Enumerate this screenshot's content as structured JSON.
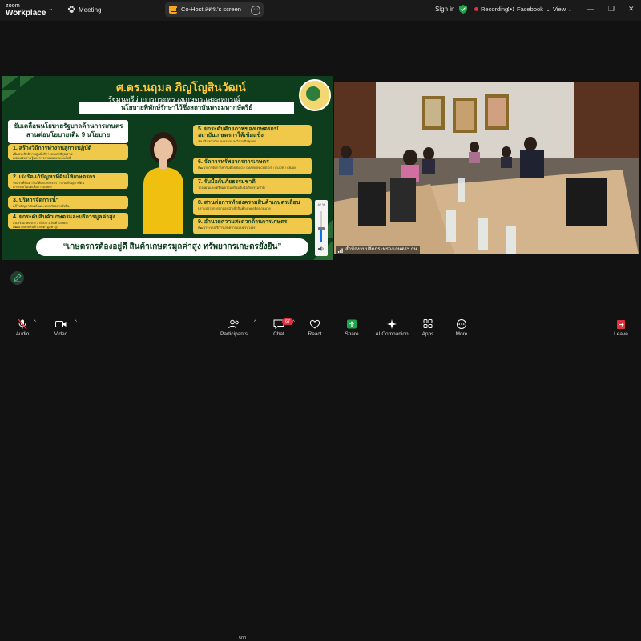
{
  "app": {
    "brand_line1": "zoom",
    "brand_line2": "Workplace",
    "meeting_label": "Meeting"
  },
  "share": {
    "label": "Co-Host สตร.'s screen"
  },
  "topbar": {
    "signin": "Sign in",
    "recording": "Recording",
    "facebook": "Facebook",
    "view": "View"
  },
  "slide": {
    "title": "ศ.ดร.นฤมล ภิญโญสินวัฒน์",
    "subtitle": "รัฐมนตรีว่าการกระทรวงเกษตรและสหกรณ์",
    "banner": "นโยบายพิทักษ์รักษาไว้ซึ่งสถาบันพระมหากษัตริย์",
    "left_head_1": "ขับเคลื่อนนโยบายรัฐบาลด้านการเกษตร",
    "left_head_2": "สานต่อนโยบายเดิม 9 นโยบาย",
    "left_items": [
      {
        "title": "1. สร้างวิถีการทำงานสู่การปฏิบัติ",
        "sub1": "เพิ่มประสิทธิภาพศูนย์บริการเกษตรพิรุณราช",
        "sub2": "เผยแพร่ความรู้และการถ่ายทอดเทคโนโลยี"
      },
      {
        "title": "2. เร่งรัดแก้ปัญหาที่ดินให้เกษตรกร",
        "sub1": "จัดสรรที่ดินทำกินให้แก่เกษตรกร / การแก้ปัญหาที่ดิน",
        "sub2": "ยกระดับโฉนดเพื่อการเกษตร"
      },
      {
        "title": "3. บริหารจัดการน้ำ",
        "sub1": "แก้ไขปัญหาภัยแล้งและอุทกภัยอย่างยั่งยืน",
        "sub2": ""
      },
      {
        "title": "4. ยกระดับสินค้าเกษตรและบริการมูลค่าสูง",
        "sub1": "ส่งเสริมเกษตรกร 1 ตำบล 1 สินค้าเกษตร",
        "sub2": "พัฒนาตลาดสินค้าเกษตรมูลค่าสูง"
      }
    ],
    "right_items": [
      {
        "title": "5. ยกระดับศักยภาพของเกษตรกร/",
        "title2": "สถาบันเกษตรกรให้เข้มแข็ง",
        "sub": "ส่งเสริมสถาบันเกษตรกรและวิสาหกิจชุมชน"
      },
      {
        "title": "6. จัดการทรัพยากรการเกษตร",
        "title2": "",
        "sub": "พัฒนาการจัดการฟาร์มด้วย BCG / CARBON CREDIT / EUDR / CBAM"
      },
      {
        "title": "7. รับมือกับภัยธรรมชาติ",
        "title2": "",
        "sub": "วางแผนและเตรียมความพร้อมรับมือภัยธรรมชาติ"
      },
      {
        "title": "8. สานต่อการทำสงครามสินค้าเกษตรเถื่อน",
        "title2": "",
        "sub": "ปราบปรามการลักลอบนำเข้าสินค้าเกษตรผิดกฎหมาย"
      },
      {
        "title": "9. อำนวยความสะดวกด้านการเกษตร",
        "title2": "",
        "sub": "พัฒนาระบบบริการเกษตรกรแบบครบวงจร"
      }
    ],
    "footer": "“เกษตรกรต้องอยู่ดี สินค้าเกษตรมูลค่าสูง ทรัพยากรเกษตรยั่งยืน”",
    "volume_label": "42 %",
    "volume_level": 0.42
  },
  "camera": {
    "name": "สำนักงานปลัดกระทรวงเกษตรฯ กษ"
  },
  "toolbar": {
    "audio": "Audio",
    "video": "Video",
    "participants": "Participants",
    "participants_count": "500",
    "chat": "Chat",
    "chat_badge": "67",
    "react": "React",
    "share": "Share",
    "ai": "AI Companion",
    "apps": "Apps",
    "more": "More",
    "leave": "Leave"
  },
  "colors": {
    "accent_green": "#1fa64a",
    "record_red": "#e0323c",
    "slide_green": "#0d3d1c",
    "slide_gold": "#f0c94a",
    "zoom_blue": "#0e71eb"
  }
}
